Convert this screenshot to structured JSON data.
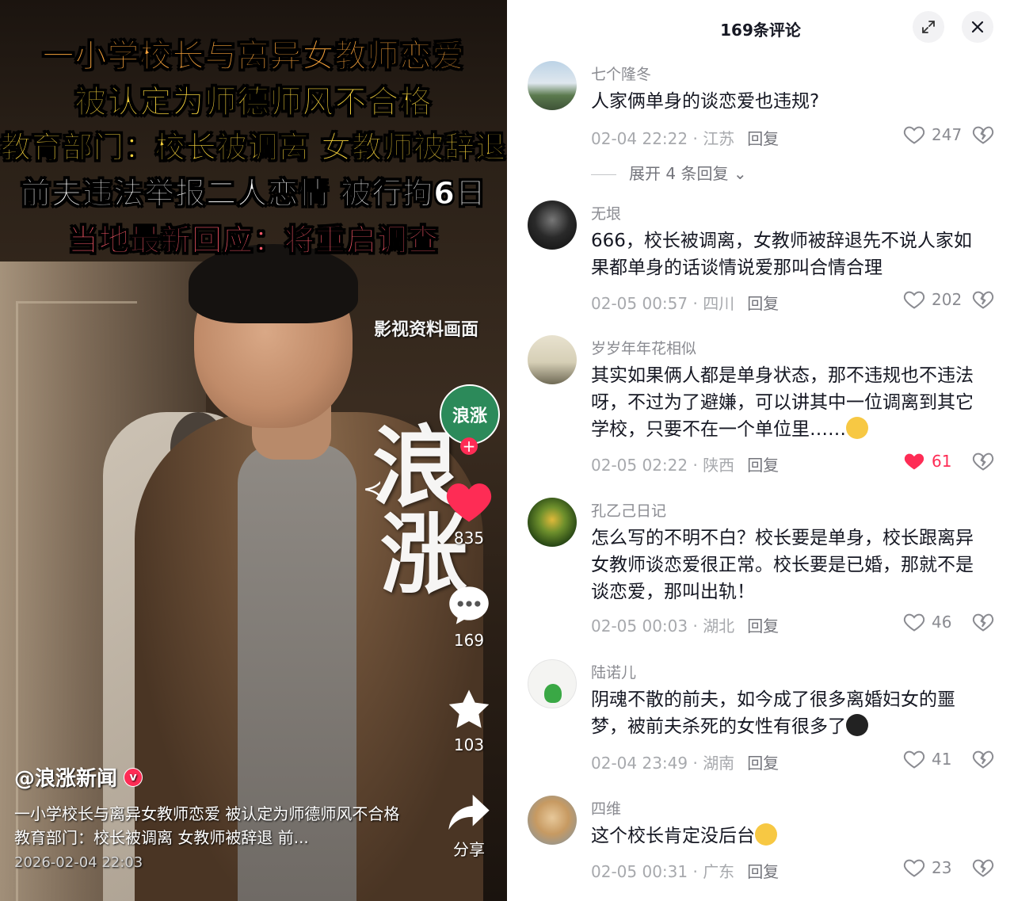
{
  "video": {
    "headlines": [
      "一小学校长与离异女教师恋爱",
      "被认定为师德师风不合格",
      "教育部门：校长被调离 女教师被辞退",
      "前夫违法举报二人恋情 被行拘6日",
      "当地最新回应：将重启调查"
    ],
    "film_note": "影视资料画面",
    "watermark": [
      "浪",
      "涨"
    ],
    "channel_avatar_text": "浪涨",
    "actions": {
      "like_count": "835",
      "comment_count": "169",
      "favorite_count": "103",
      "share_label": "分享"
    },
    "author": "@浪涨新闻",
    "description": "一小学校长与离异女教师恋爱 被认定为师德师风不合格 教育部门：校长被调离 女教师被辞退 前...",
    "post_date": "2026-02-04 22:03",
    "colors": {
      "like_red": "#fe2c55",
      "headline_orange": "#f7a23a",
      "headline_yellow": "#f9d43c",
      "headline_pink": "#ff5a6a"
    }
  },
  "comments_panel": {
    "title": "169条评论",
    "icons": {
      "expand": "expand-icon",
      "close": "close-icon"
    },
    "reply_label": "回复",
    "comments": [
      {
        "user": "七个隆冬",
        "text": "人家俩单身的谈恋爱也违规?",
        "date": "02-04 22:22",
        "location": "江苏",
        "likes": "247",
        "liked": false,
        "expand": "展开 4 条回复"
      },
      {
        "user": "无垠",
        "text": "666，校长被调离，女教师被辞退先不说人家如果都单身的话谈情说爱那叫合情合理",
        "date": "02-05 00:57",
        "location": "四川",
        "likes": "202",
        "liked": false
      },
      {
        "user": "岁岁年年花相似",
        "text": "其实如果俩人都是单身状态，那不违规也不违法呀，不过为了避嫌，可以讲其中一位调离到其它学校，只要不在一个单位里……",
        "date": "02-05 02:22",
        "location": "陕西",
        "likes": "61",
        "liked": true
      },
      {
        "user": "孔乙己日记",
        "text": "怎么写的不明不白？校长要是单身，校长跟离异女教师谈恋爱很正常。校长要是已婚，那就不是谈恋爱，那叫出轨！",
        "date": "02-05 00:03",
        "location": "湖北",
        "likes": "46",
        "liked": false
      },
      {
        "user": "陆诺儿",
        "text": "阴魂不散的前夫，如今成了很多离婚妇女的噩梦，被前夫杀死的女性有很多了",
        "date": "02-04 23:49",
        "location": "湖南",
        "likes": "41",
        "liked": false
      },
      {
        "user": "四维",
        "text": "这个校长肯定没后台",
        "date": "02-05 00:31",
        "location": "广东",
        "likes": "23",
        "liked": false
      }
    ]
  }
}
